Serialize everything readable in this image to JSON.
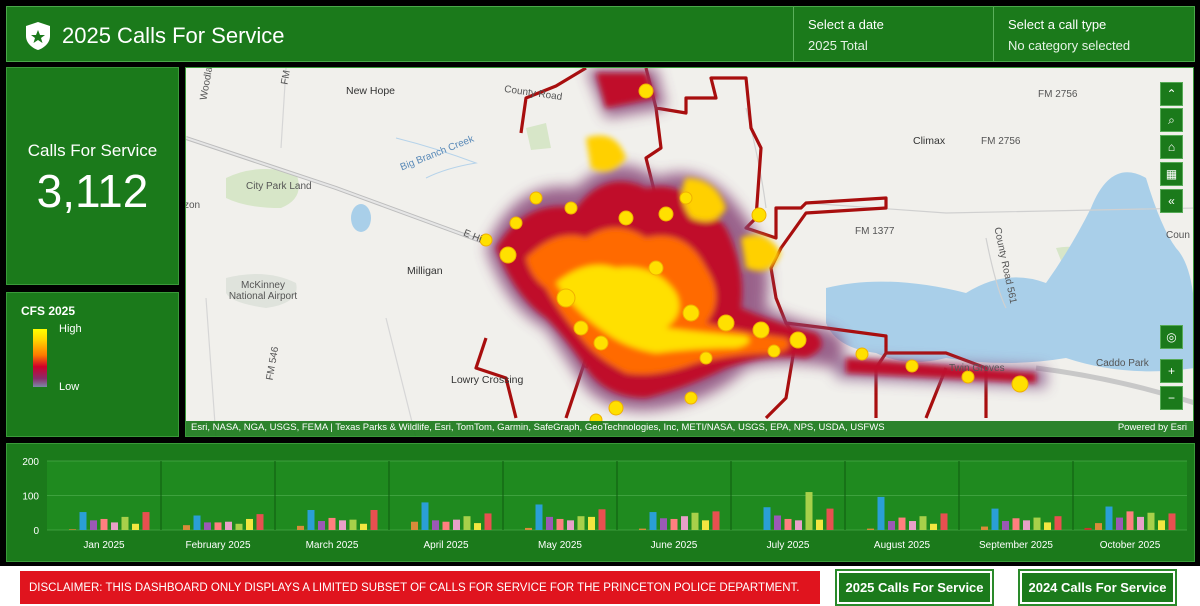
{
  "header": {
    "title": "2025 Calls For Service",
    "date_label": "Select a date",
    "date_value": "2025 Total",
    "call_type_label": "Select a call type",
    "call_type_value": "No category selected"
  },
  "kpi": {
    "label": "Calls For Service",
    "value": "3,112"
  },
  "legend": {
    "title": "CFS 2025",
    "high": "High",
    "low": "Low"
  },
  "map": {
    "places": [
      "New Hope",
      "Climax",
      "City Park Land",
      "Milligan",
      "McKinney National Airport",
      "Lowry Crossing",
      "Twin Groves",
      "Caddo Park",
      "Big Branch Creek",
      "County Road",
      "FM 2756",
      "FM 2756",
      "FM 1377",
      "County Road 561",
      "FM 546",
      "E Hi",
      "zon",
      "Coun",
      "Woodla",
      "FM"
    ],
    "attribution": "Esri, NASA, NGA, USGS, FEMA | Texas Parks & Wildlife, Esri, TomTom, Garmin, SafeGraph, GeoTechnologies, Inc, METI/NASA, USGS, EPA, NPS, USDA, USFWS",
    "powered_by": "Powered by Esri",
    "tools": [
      "expand-icon",
      "search-icon",
      "home-icon",
      "qr-icon",
      "collapse-icon",
      "locate-icon",
      "zoom-in-icon",
      "zoom-out-icon"
    ],
    "tool_glyphs": {
      "expand": "⌃",
      "search": "⌕",
      "home": "⌂",
      "qr": "▦",
      "collapse": "«",
      "locate": "◎",
      "zoom_in": "+",
      "zoom_out": "−"
    }
  },
  "chart_data": {
    "type": "bar",
    "ylim": [
      0,
      200
    ],
    "yticks": [
      0,
      100,
      200
    ],
    "categories": [
      "Jan 2025",
      "February 2025",
      "March 2025",
      "April 2025",
      "May 2025",
      "June 2025",
      "July 2025",
      "August 2025",
      "September 2025",
      "October 2025"
    ],
    "colors": [
      "#c0392b",
      "#d98b3a",
      "#2a9fd6",
      "#9b59b6",
      "#ff7f7f",
      "#e8a0c8",
      "#a8d04a",
      "#f2e640",
      "#e85050",
      "#1bb0a0"
    ],
    "series_values": [
      [
        0,
        2,
        52,
        28,
        32,
        22,
        38,
        18,
        52
      ],
      [
        0,
        14,
        42,
        22,
        22,
        24,
        18,
        32,
        46
      ],
      [
        0,
        12,
        58,
        26,
        35,
        28,
        30,
        18,
        58
      ],
      [
        0,
        24,
        80,
        28,
        24,
        30,
        40,
        20,
        48
      ],
      [
        0,
        6,
        74,
        38,
        32,
        28,
        40,
        38,
        60
      ],
      [
        0,
        4,
        52,
        34,
        32,
        40,
        50,
        28,
        54
      ],
      [
        0,
        0,
        66,
        42,
        32,
        28,
        110,
        30,
        62
      ],
      [
        0,
        4,
        96,
        26,
        36,
        26,
        40,
        18,
        48
      ],
      [
        0,
        10,
        62,
        26,
        34,
        28,
        36,
        22,
        40
      ],
      [
        6,
        20,
        68,
        36,
        54,
        38,
        50,
        28,
        48
      ]
    ]
  },
  "footer": {
    "disclaimer": "DISCLAIMER: THIS DASHBOARD ONLY DISPLAYS A LIMITED SUBSET OF CALLS FOR SERVICE FOR THE PRINCETON POLICE DEPARTMENT.",
    "btn_2025": "2025 Calls For Service",
    "btn_2024": "2024 Calls For Service"
  }
}
